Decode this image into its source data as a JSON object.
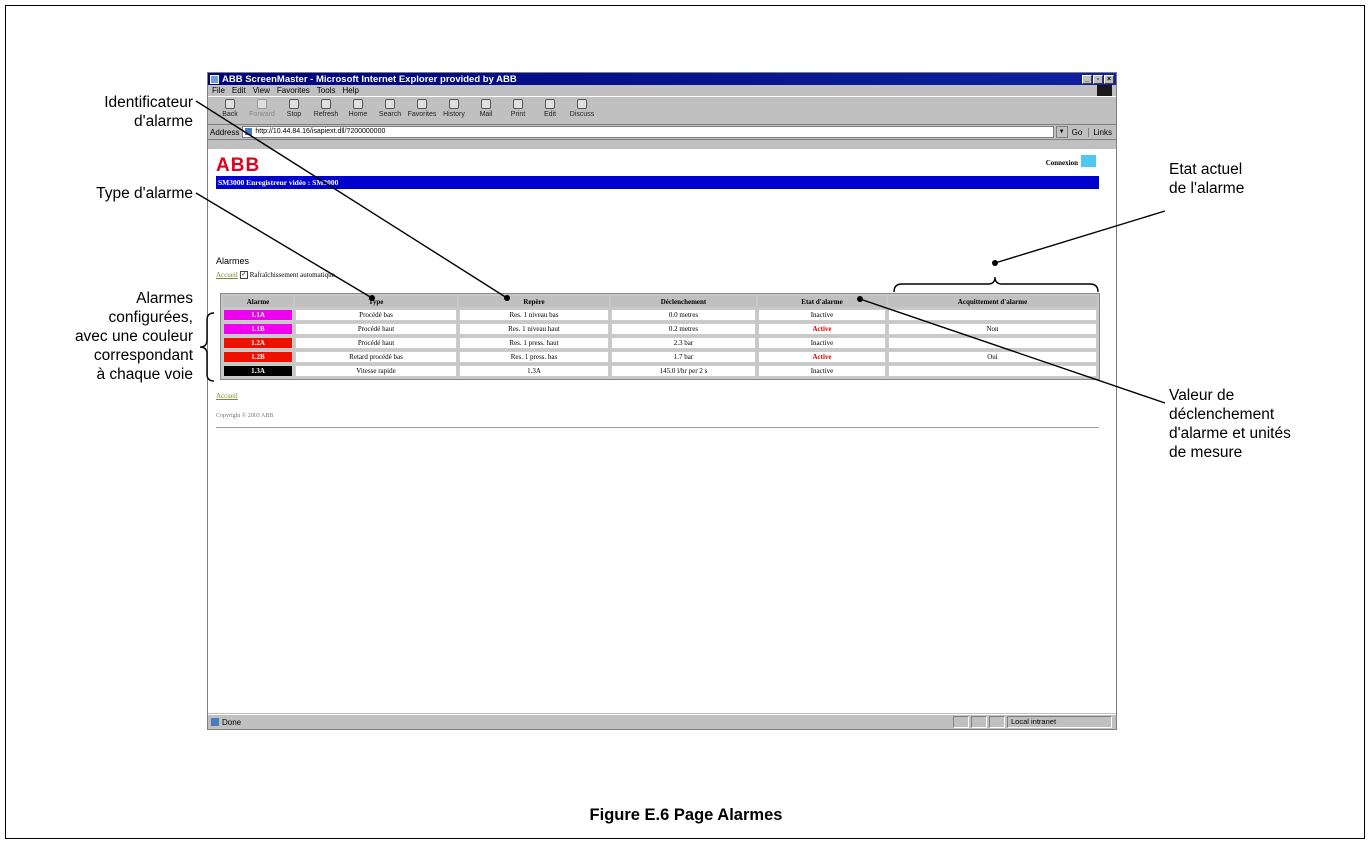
{
  "figure": {
    "caption": "Figure E.6 Page Alarmes",
    "callouts": {
      "id_alarme": [
        "Identificateur",
        "d'alarme"
      ],
      "type_alarme": [
        "Type d'alarme"
      ],
      "alarmes_config": [
        "Alarmes",
        "configurées,",
        "avec une couleur",
        "correspondant",
        "à chaque voie"
      ],
      "etat_actuel": [
        "Etat actuel",
        "de l'alarme"
      ],
      "valeur_declenchement": [
        "Valeur de",
        "déclenchement",
        "d'alarme et unités",
        "de mesure"
      ]
    }
  },
  "browser": {
    "title": "ABB ScreenMaster - Microsoft Internet Explorer provided by ABB",
    "menu": [
      "File",
      "Edit",
      "View",
      "Favorites",
      "Tools",
      "Help"
    ],
    "toolbar": [
      "Back",
      "Forward",
      "Stop",
      "Refresh",
      "Home",
      "Search",
      "Favorites",
      "History",
      "Mail",
      "Print",
      "Edit",
      "Discuss"
    ],
    "address_label": "Address",
    "address_value": "http://10.44.84.16/isapiext.dll/?200000000",
    "go_label": "Go",
    "links_label": "Links",
    "status_text": "Done",
    "zone_text": "Local intranet"
  },
  "page": {
    "logo": "ABB",
    "connexion": "Connexion",
    "banner": "SM3000 Enregistreur vidéo : SM3000",
    "title": "Alarmes",
    "nav_link": "Accueil",
    "auto_refresh_label": "Rafraîchissement automatique",
    "footer_link": "Accueil",
    "copyright": "Copyright © 2003 ABB"
  },
  "table": {
    "headers": [
      "Alarme",
      "Type",
      "Repère",
      "Déclenchement",
      "Etat d'alarme",
      "Acquittement d'alarme"
    ],
    "rows": [
      {
        "id": "1.1A",
        "color": "#ee00ee",
        "type": "Procédé bas",
        "tag": "Res. 1 niveau bas",
        "trip": "0.0 metres",
        "state": "Inactive",
        "active": false,
        "ack": ""
      },
      {
        "id": "1.1B",
        "color": "#ee00ee",
        "type": "Procédé haut",
        "tag": "Res. 1 niveau haut",
        "trip": "0.2 metres",
        "state": "Active",
        "active": true,
        "ack": "Non"
      },
      {
        "id": "1.2A",
        "color": "#ee1100",
        "type": "Procédé haut",
        "tag": "Res. 1 press. haut",
        "trip": "2.3 bar",
        "state": "Inactive",
        "active": false,
        "ack": ""
      },
      {
        "id": "1.2B",
        "color": "#ee1100",
        "type": "Retard procédé bas",
        "tag": "Res. 1 press. bas",
        "trip": "1.7 bar",
        "state": "Active",
        "active": true,
        "ack": "Oui"
      },
      {
        "id": "1.3A",
        "color": "#000000",
        "type": "Vitesse rapide",
        "tag": "1.3A",
        "trip": "145.0 l/hr per 2 s",
        "state": "Inactive",
        "active": false,
        "ack": ""
      }
    ]
  }
}
